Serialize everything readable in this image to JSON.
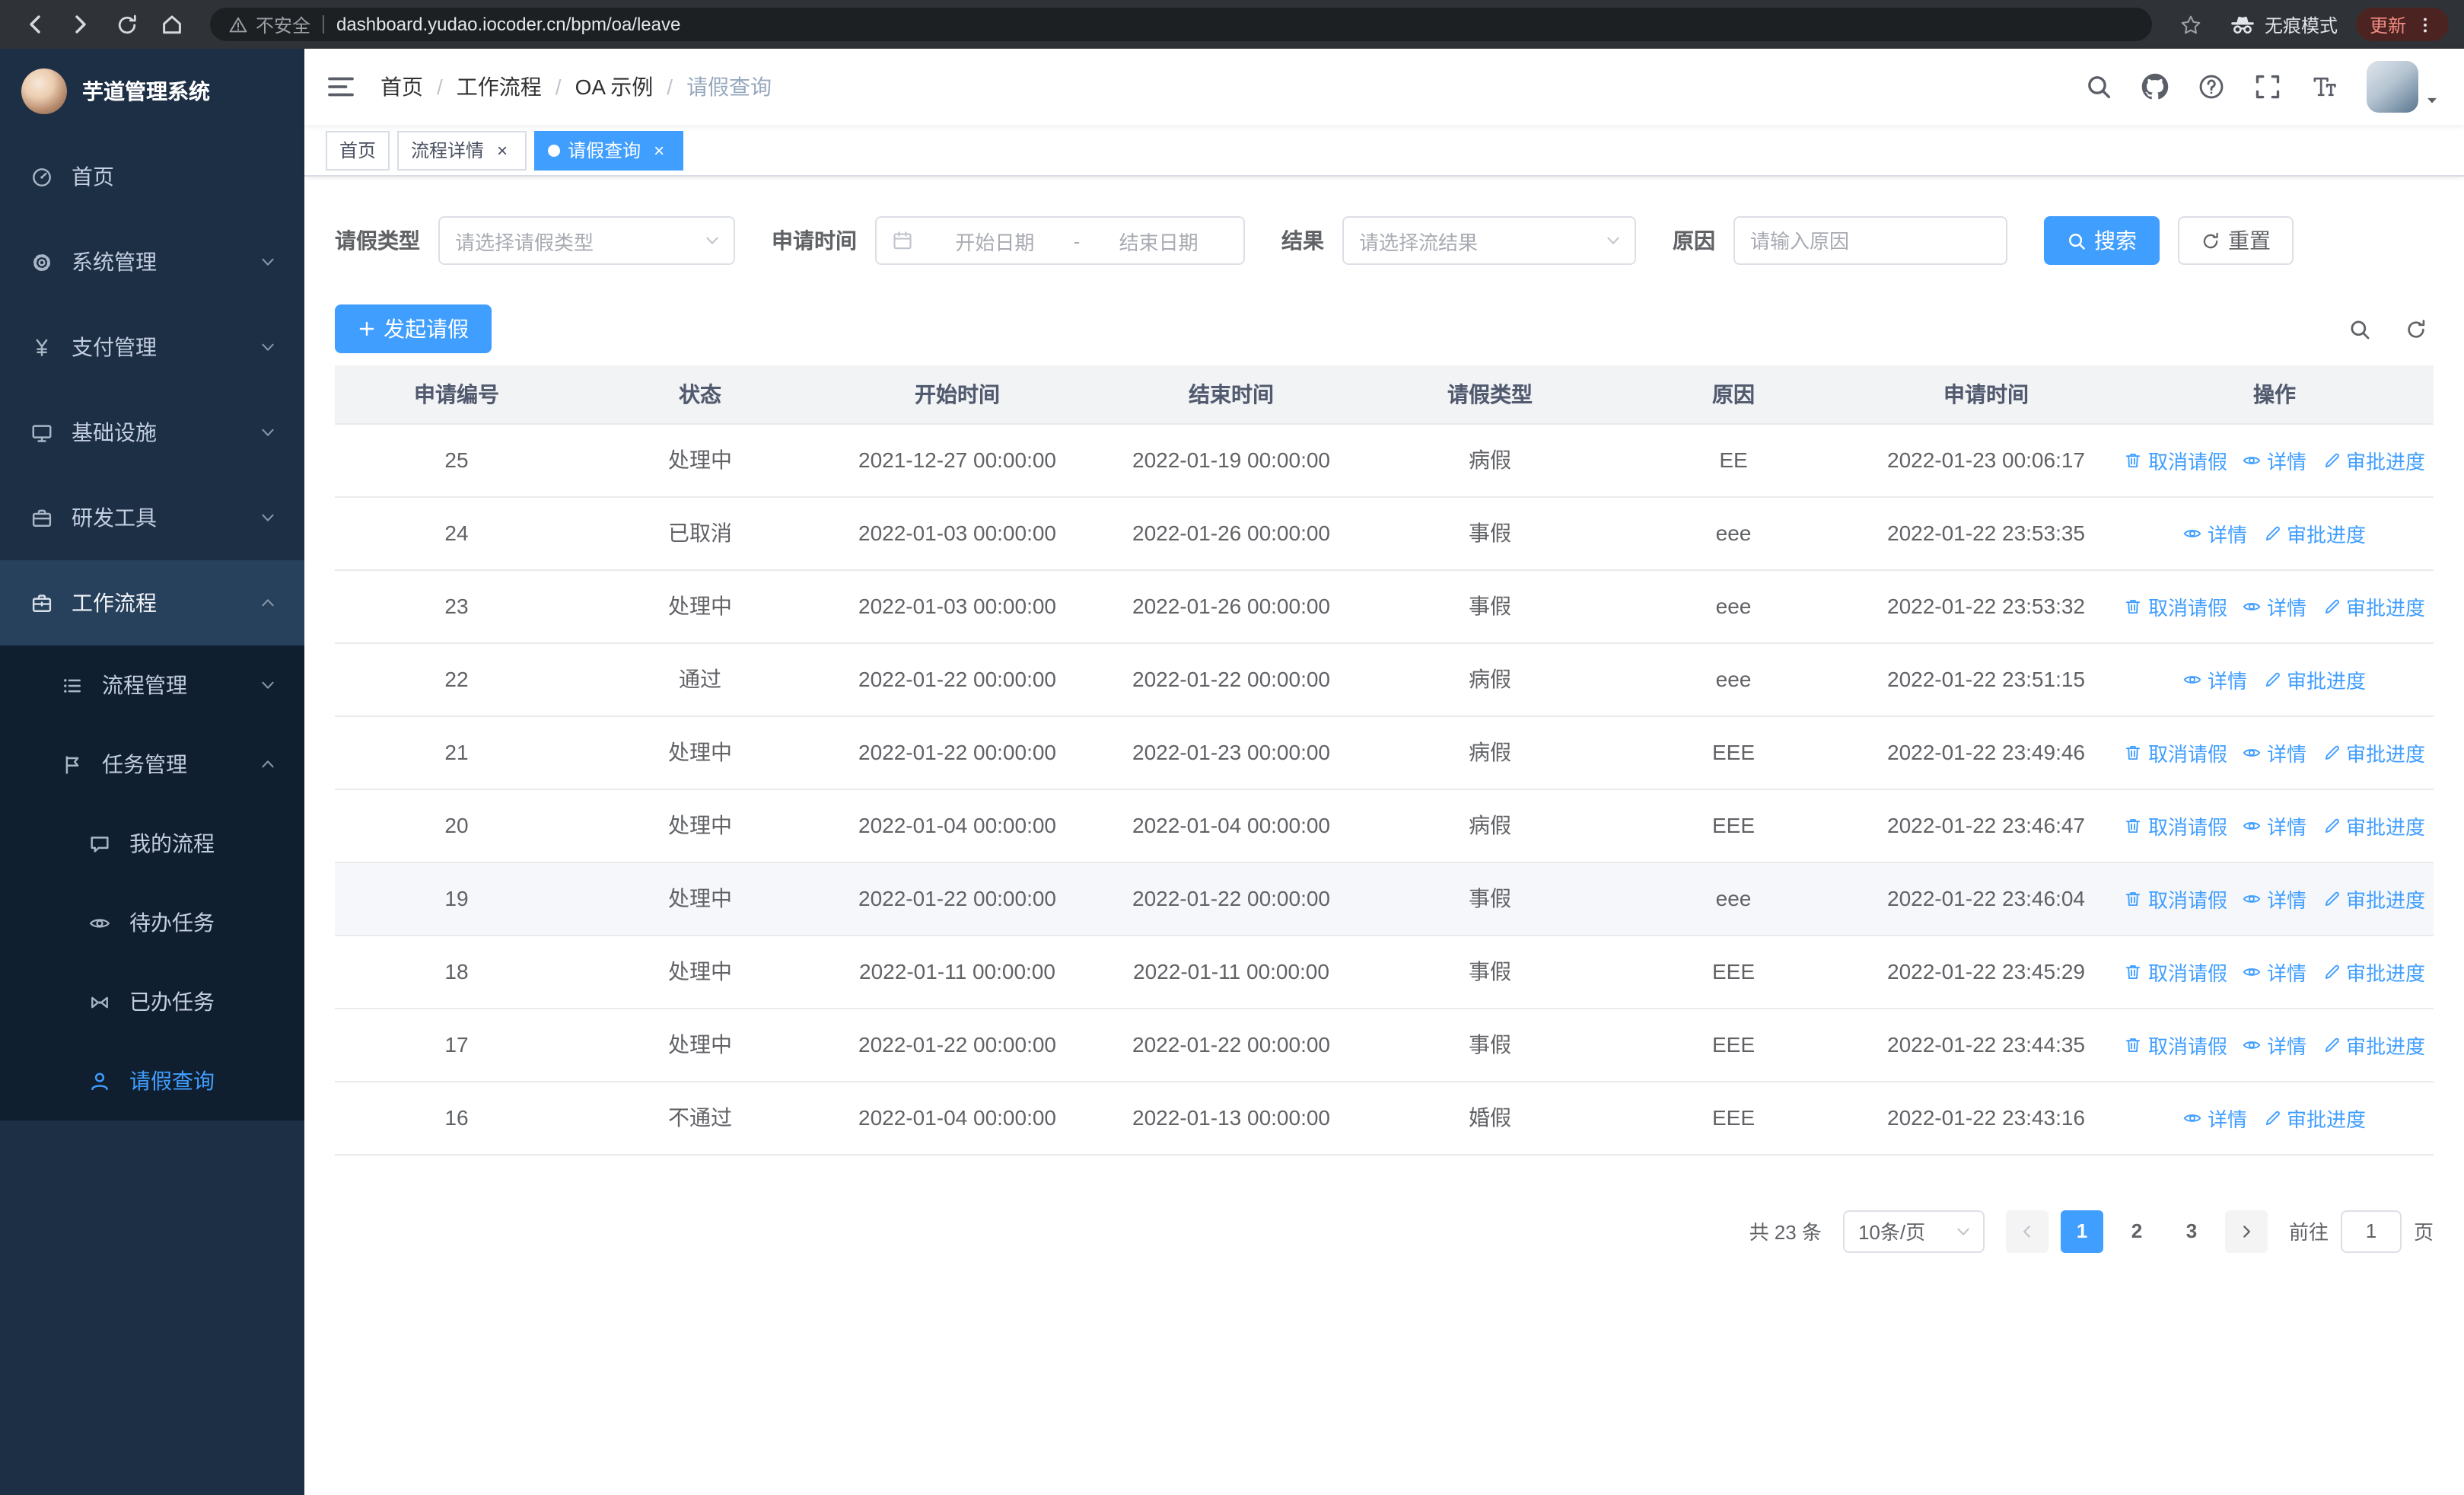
{
  "browser": {
    "security_label": "不安全",
    "url": "dashboard.yudao.iocoder.cn/bpm/oa/leave",
    "incognito_label": "无痕模式",
    "update_label": "更新"
  },
  "app": {
    "logo_title": "芋道管理系统"
  },
  "sidebar": {
    "menu": [
      {
        "name": "home",
        "label": "首页",
        "icon": "dashboard-icon",
        "level": 1
      },
      {
        "name": "system-management",
        "label": "系统管理",
        "icon": "gear-icon",
        "level": 1,
        "arrow": "down"
      },
      {
        "name": "payment-management",
        "label": "支付管理",
        "icon": "yen-icon",
        "level": 1,
        "arrow": "down"
      },
      {
        "name": "infrastructure",
        "label": "基础设施",
        "icon": "monitor-icon",
        "level": 1,
        "arrow": "down"
      },
      {
        "name": "dev-tools",
        "label": "研发工具",
        "icon": "toolbox-icon",
        "level": 1,
        "arrow": "down"
      },
      {
        "name": "workflow",
        "label": "工作流程",
        "icon": "briefcase-icon",
        "level": 1,
        "arrow": "up",
        "open": true
      },
      {
        "name": "process-management",
        "label": "流程管理",
        "icon": "list-icon",
        "level": 2,
        "arrow": "down"
      },
      {
        "name": "task-management",
        "label": "任务管理",
        "icon": "flag-icon",
        "level": 2,
        "arrow": "up",
        "open": true
      },
      {
        "name": "my-process",
        "label": "我的流程",
        "icon": "chat-icon",
        "level": 3
      },
      {
        "name": "todo-task",
        "label": "待办任务",
        "icon": "eye-icon",
        "level": 3
      },
      {
        "name": "done-task",
        "label": "已办任务",
        "icon": "bowtie-icon",
        "level": 3
      },
      {
        "name": "leave-query",
        "label": "请假查询",
        "icon": "user-icon",
        "level": 3,
        "active": true
      }
    ]
  },
  "breadcrumb": [
    "首页",
    "工作流程",
    "OA 示例",
    "请假查询"
  ],
  "tabs": [
    {
      "name": "home",
      "label": "首页",
      "closable": false,
      "active": false
    },
    {
      "name": "process-detail",
      "label": "流程详情",
      "closable": true,
      "active": false
    },
    {
      "name": "leave-query",
      "label": "请假查询",
      "closable": true,
      "active": true
    }
  ],
  "filters": {
    "leave_type_label": "请假类型",
    "leave_type_placeholder": "请选择请假类型",
    "apply_time_label": "申请时间",
    "start_date_placeholder": "开始日期",
    "range_separator": "-",
    "end_date_placeholder": "结束日期",
    "result_label": "结果",
    "result_placeholder": "请选择流结果",
    "reason_label": "原因",
    "reason_placeholder": "请输入原因",
    "search_button": "搜索",
    "reset_button": "重置"
  },
  "toolbar": {
    "create_button": "发起请假"
  },
  "table": {
    "columns": [
      "申请编号",
      "状态",
      "开始时间",
      "结束时间",
      "请假类型",
      "原因",
      "申请时间",
      "操作"
    ],
    "op_labels": {
      "cancel": "取消请假",
      "detail": "详情",
      "progress": "审批进度"
    },
    "rows": [
      {
        "id": "25",
        "status": "处理中",
        "start": "2021-12-27 00:00:00",
        "end": "2022-01-19 00:00:00",
        "type": "病假",
        "reason": "EE",
        "apply_time": "2022-01-23 00:06:17",
        "ops": [
          "cancel",
          "detail",
          "progress"
        ]
      },
      {
        "id": "24",
        "status": "已取消",
        "start": "2022-01-03 00:00:00",
        "end": "2022-01-26 00:00:00",
        "type": "事假",
        "reason": "eee",
        "apply_time": "2022-01-22 23:53:35",
        "ops": [
          "detail",
          "progress"
        ]
      },
      {
        "id": "23",
        "status": "处理中",
        "start": "2022-01-03 00:00:00",
        "end": "2022-01-26 00:00:00",
        "type": "事假",
        "reason": "eee",
        "apply_time": "2022-01-22 23:53:32",
        "ops": [
          "cancel",
          "detail",
          "progress"
        ]
      },
      {
        "id": "22",
        "status": "通过",
        "start": "2022-01-22 00:00:00",
        "end": "2022-01-22 00:00:00",
        "type": "病假",
        "reason": "eee",
        "apply_time": "2022-01-22 23:51:15",
        "ops": [
          "detail",
          "progress"
        ]
      },
      {
        "id": "21",
        "status": "处理中",
        "start": "2022-01-22 00:00:00",
        "end": "2022-01-23 00:00:00",
        "type": "病假",
        "reason": "EEE",
        "apply_time": "2022-01-22 23:49:46",
        "ops": [
          "cancel",
          "detail",
          "progress"
        ]
      },
      {
        "id": "20",
        "status": "处理中",
        "start": "2022-01-04 00:00:00",
        "end": "2022-01-04 00:00:00",
        "type": "病假",
        "reason": "EEE",
        "apply_time": "2022-01-22 23:46:47",
        "ops": [
          "cancel",
          "detail",
          "progress"
        ]
      },
      {
        "id": "19",
        "status": "处理中",
        "start": "2022-01-22 00:00:00",
        "end": "2022-01-22 00:00:00",
        "type": "事假",
        "reason": "eee",
        "apply_time": "2022-01-22 23:46:04",
        "ops": [
          "cancel",
          "detail",
          "progress"
        ],
        "highlighted": true
      },
      {
        "id": "18",
        "status": "处理中",
        "start": "2022-01-11 00:00:00",
        "end": "2022-01-11 00:00:00",
        "type": "事假",
        "reason": "EEE",
        "apply_time": "2022-01-22 23:45:29",
        "ops": [
          "cancel",
          "detail",
          "progress"
        ]
      },
      {
        "id": "17",
        "status": "处理中",
        "start": "2022-01-22 00:00:00",
        "end": "2022-01-22 00:00:00",
        "type": "事假",
        "reason": "EEE",
        "apply_time": "2022-01-22 23:44:35",
        "ops": [
          "cancel",
          "detail",
          "progress"
        ]
      },
      {
        "id": "16",
        "status": "不通过",
        "start": "2022-01-04 00:00:00",
        "end": "2022-01-13 00:00:00",
        "type": "婚假",
        "reason": "EEE",
        "apply_time": "2022-01-22 23:43:16",
        "ops": [
          "detail",
          "progress"
        ]
      }
    ]
  },
  "pagination": {
    "total_text": "共 23 条",
    "page_size_text": "10条/页",
    "pages": [
      "1",
      "2",
      "3"
    ],
    "active_page": "1",
    "goto_label": "前往",
    "goto_value": "1",
    "goto_suffix": "页"
  },
  "colors": {
    "primary": "#409eff",
    "sidebar_bg": "#1d2f45",
    "submenu_bg": "#101f2f",
    "table_header_bg": "#f2f3f5",
    "update_badge_text": "#f28b82"
  }
}
